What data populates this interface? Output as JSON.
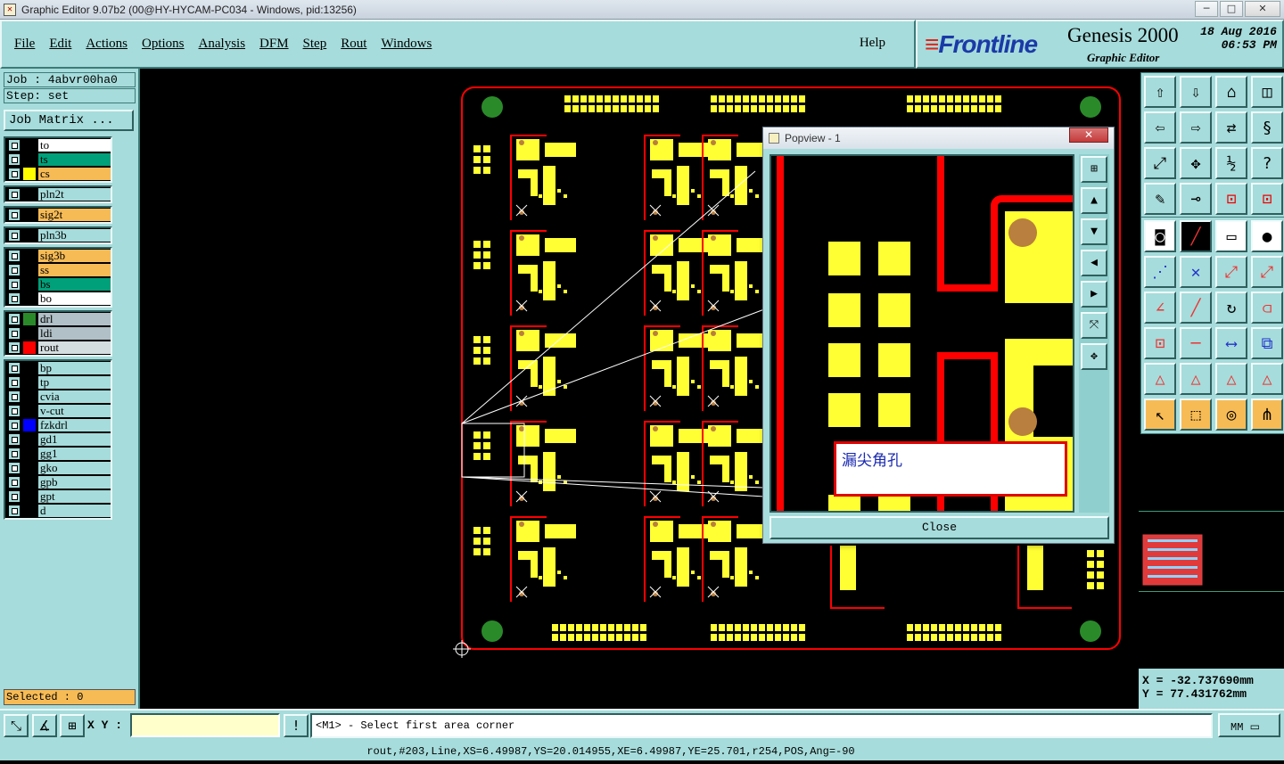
{
  "window": {
    "title": "Graphic Editor 9.07b2 (00@HY-HYCAM-PC034 - Windows, pid:13256)",
    "minimize_label": "─",
    "maximize_label": "□",
    "close_label": "✕"
  },
  "menu": {
    "file": "File",
    "edit": "Edit",
    "actions": "Actions",
    "options": "Options",
    "analysis": "Analysis",
    "dfm": "DFM",
    "step": "Step",
    "rout": "Rout",
    "windows": "Windows",
    "help": "Help"
  },
  "brand": {
    "logo": "Frontline",
    "product": "Genesis 2000",
    "subtitle": "Graphic Editor",
    "date": "18 Aug 2016",
    "time": "06:53 PM"
  },
  "job": {
    "job_label": "Job : 4abvr00ha0",
    "step_label": "Step: set",
    "matrix_button": "Job Matrix ..."
  },
  "layer_groups": [
    [
      {
        "name": "to",
        "swatch": "#000000",
        "color": "#ffffff"
      },
      {
        "name": "ts",
        "swatch": "#000000",
        "color": "#00a07a"
      },
      {
        "name": "cs",
        "swatch": "#ffff00",
        "color": "#f7bb55"
      }
    ],
    [
      {
        "name": "pln2t",
        "swatch": "#000000",
        "color": "#a6dcdb"
      }
    ],
    [
      {
        "name": "sig2t",
        "swatch": "#000000",
        "color": "#f7bb55"
      }
    ],
    [
      {
        "name": "pln3b",
        "swatch": "#000000",
        "color": "#a6dcdb"
      }
    ],
    [
      {
        "name": "sig3b",
        "swatch": "#000000",
        "color": "#f7bb55"
      },
      {
        "name": "ss",
        "swatch": "#000000",
        "color": "#f7bb55"
      },
      {
        "name": "bs",
        "swatch": "#000000",
        "color": "#00a07a"
      },
      {
        "name": "bo",
        "swatch": "#000000",
        "color": "#ffffff"
      }
    ],
    [
      {
        "name": "drl",
        "swatch": "#2a8a2a",
        "color": "#b0c0c6"
      },
      {
        "name": "ldi",
        "swatch": "#000000",
        "color": "#b0c0c6"
      },
      {
        "name": "rout",
        "swatch": "#ff0000",
        "color": "#d4dde0"
      }
    ],
    [
      {
        "name": "bp",
        "swatch": "#000000",
        "color": "#a6dcdb"
      },
      {
        "name": "tp",
        "swatch": "#000000",
        "color": "#a6dcdb"
      },
      {
        "name": "cvia",
        "swatch": "#000000",
        "color": "#a6dcdb"
      },
      {
        "name": "v-cut",
        "swatch": "#000000",
        "color": "#a6dcdb"
      },
      {
        "name": "fzkdrl",
        "swatch": "#0000ff",
        "color": "#a6dcdb"
      },
      {
        "name": "gd1",
        "swatch": "#000000",
        "color": "#a6dcdb"
      },
      {
        "name": "gg1",
        "swatch": "#000000",
        "color": "#a6dcdb"
      },
      {
        "name": "gko",
        "swatch": "#000000",
        "color": "#a6dcdb"
      },
      {
        "name": "gpb",
        "swatch": "#000000",
        "color": "#a6dcdb"
      },
      {
        "name": "gpt",
        "swatch": "#000000",
        "color": "#a6dcdb"
      },
      {
        "name": "d",
        "swatch": "#000000",
        "color": "#a6dcdb"
      }
    ]
  ],
  "selected": "Selected : 0",
  "status": {
    "xy_label": "X Y :",
    "xy_value": "",
    "prompt": "<M1> - Select first area corner",
    "units": "MM"
  },
  "coords": {
    "x": "X = -32.737690mm",
    "y": "Y =  77.431762mm"
  },
  "info": "rout,#203,Line,XS=6.49987,YS=20.014955,XE=6.49987,YE=25.701,r254,POS,Ang=-90",
  "popview": {
    "title": "Popview - 1",
    "close_label": "Close",
    "note": "漏尖角孔"
  },
  "colors": {
    "panel": "#a6dcdb",
    "copper": "#ffff33",
    "rout": "#ff0000",
    "drill": "#2a8a2a"
  }
}
